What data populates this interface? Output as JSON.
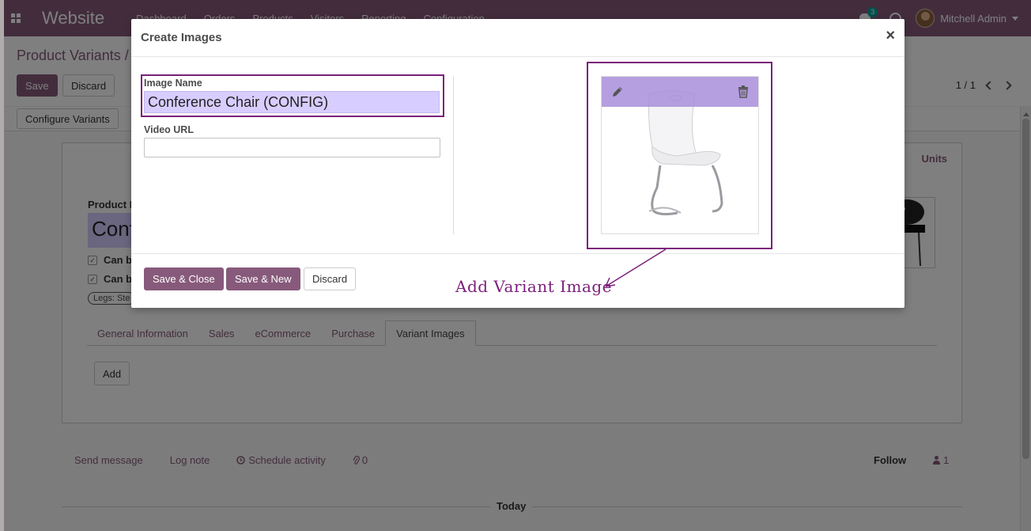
{
  "navbar": {
    "app_name": "Website",
    "menu": [
      "Dashboard",
      "Orders",
      "Products",
      "Visitors",
      "Reporting",
      "Configuration"
    ],
    "chat_count": "3",
    "user_name": "Mitchell Admin"
  },
  "control_panel": {
    "breadcrumb": "Product Variants /",
    "save_label": "Save",
    "discard_label": "Discard",
    "pager": "1 / 1",
    "configure_label": "Configure Variants"
  },
  "sheet": {
    "stat_button": "Units",
    "product_label": "Product N",
    "product_name": "Conf",
    "can_be_sold": "Can b",
    "can_be_purchased": "Can b",
    "tag": "Legs: Ste",
    "tabs": [
      "General Information",
      "Sales",
      "eCommerce",
      "Purchase",
      "Variant Images"
    ],
    "add_label": "Add"
  },
  "chatter": {
    "send_message": "Send message",
    "log_note": "Log note",
    "schedule_activity": "Schedule activity",
    "attachments": "0",
    "follow": "Follow",
    "followers": "1",
    "today": "Today"
  },
  "modal": {
    "title": "Create Images",
    "close": "×",
    "image_name_label": "Image Name",
    "image_name_value": "Conference Chair (CONFIG)",
    "video_url_label": "Video URL",
    "video_url_value": "",
    "save_close": "Save & Close",
    "save_new": "Save & New",
    "discard": "Discard"
  },
  "annotation": "Add Variant Image",
  "colors": {
    "brand": "#875a7b",
    "annotation": "#7b1f7b",
    "highlight_input": "#d8cdff"
  },
  "icons": [
    "apps-icon",
    "chat-icon",
    "clock-icon",
    "pencil-icon",
    "trash-icon",
    "close-icon",
    "paperclip-icon",
    "person-icon"
  ]
}
